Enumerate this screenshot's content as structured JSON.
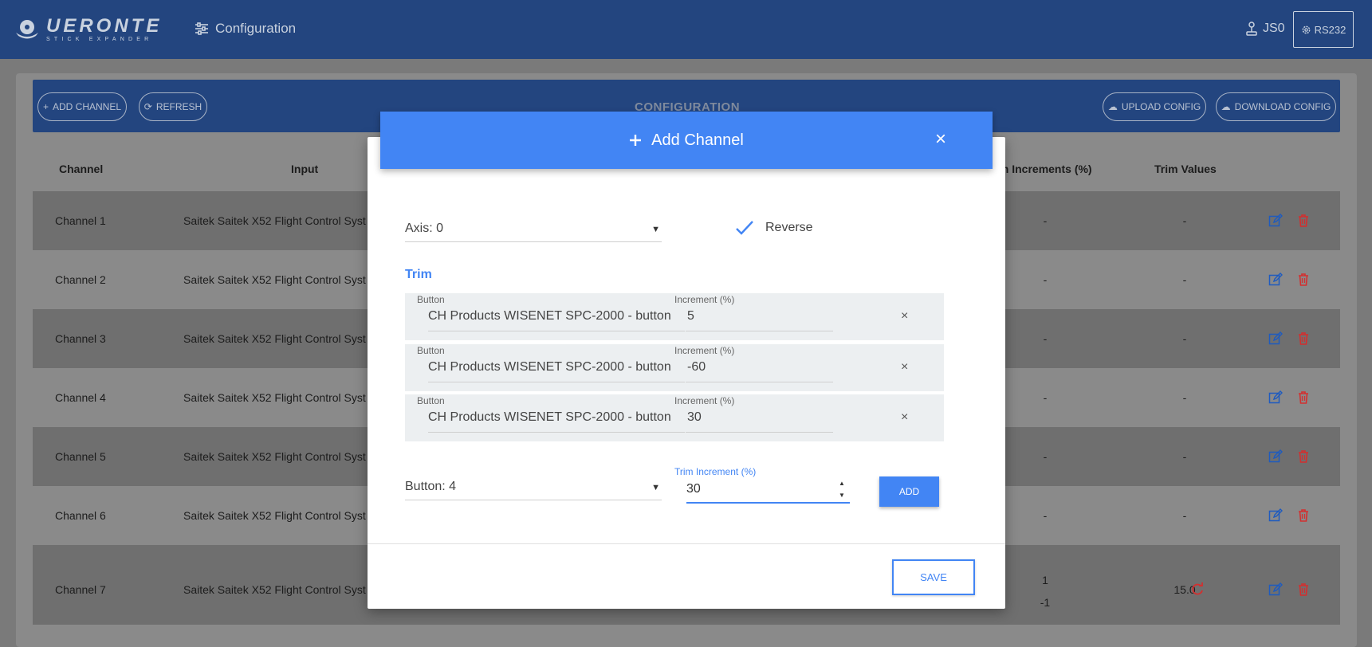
{
  "app": {
    "logo_title": "UERONTE",
    "logo_subtitle": "STICK EXPANDER",
    "nav_configuration": "Configuration",
    "nav_user": "JS0",
    "nav_serial": "RS232"
  },
  "toolbar": {
    "add_channel": "ADD CHANNEL",
    "refresh": "REFRESH",
    "title": "CONFIGURATION",
    "upload_config": "UPLOAD CONFIG",
    "download_config": "DOWNLOAD CONFIG"
  },
  "table": {
    "headers": {
      "channel": "Channel",
      "input": "Input",
      "trim_increments": "im Increments (%)",
      "trim_values": "Trim Values"
    },
    "rows": [
      {
        "channel": "Channel 1",
        "input": "Saitek Saitek X52 Flight Control Syst",
        "trim_inc": "-",
        "trim_inc2": "",
        "trim_val": "-"
      },
      {
        "channel": "Channel 2",
        "input": "Saitek Saitek X52 Flight Control Syst",
        "trim_inc": "-",
        "trim_inc2": "",
        "trim_val": "-"
      },
      {
        "channel": "Channel 3",
        "input": "Saitek Saitek X52 Flight Control Syst",
        "trim_inc": "-",
        "trim_inc2": "",
        "trim_val": "-"
      },
      {
        "channel": "Channel 4",
        "input": "Saitek Saitek X52 Flight Control Syst",
        "trim_inc": "-",
        "trim_inc2": "",
        "trim_val": "-"
      },
      {
        "channel": "Channel 5",
        "input": "Saitek Saitek X52 Flight Control Syst",
        "trim_inc": "-",
        "trim_inc2": "",
        "trim_val": "-"
      },
      {
        "channel": "Channel 6",
        "input": "Saitek Saitek X52 Flight Control Syst",
        "trim_inc": "-",
        "trim_inc2": "",
        "trim_val": "-"
      },
      {
        "channel": "Channel 7",
        "input": "Saitek Saitek X52 Flight Control Syst",
        "trim_inc": "1",
        "trim_inc2": "-1",
        "trim_val": "15.0"
      }
    ]
  },
  "modal": {
    "title": "Add Channel",
    "close": "×",
    "axis_select": "Axis: 0",
    "reverse_label": "Reverse",
    "trim_section": "Trim",
    "trims": [
      {
        "button_label": "Button",
        "button_value": "CH Products WISENET SPC-2000 - button",
        "increment_label": "Increment (%)",
        "increment_value": "5",
        "remove": "×"
      },
      {
        "button_label": "Button",
        "button_value": "CH Products WISENET SPC-2000 - button",
        "increment_label": "Increment (%)",
        "increment_value": "-60",
        "remove": "×"
      },
      {
        "button_label": "Button",
        "button_value": "CH Products WISENET SPC-2000 - button",
        "increment_label": "Increment (%)",
        "increment_value": "30",
        "remove": "×"
      }
    ],
    "button_select": "Button: 4",
    "trim_increment_label": "Trim Increment (%)",
    "trim_increment_value": "30",
    "add_button": "ADD",
    "save_button": "SAVE"
  },
  "colors": {
    "nav_bg": "#23457f",
    "accent": "#4285f4",
    "delete_red": "#d32f2f",
    "edit_blue": "#1e5bbf"
  }
}
